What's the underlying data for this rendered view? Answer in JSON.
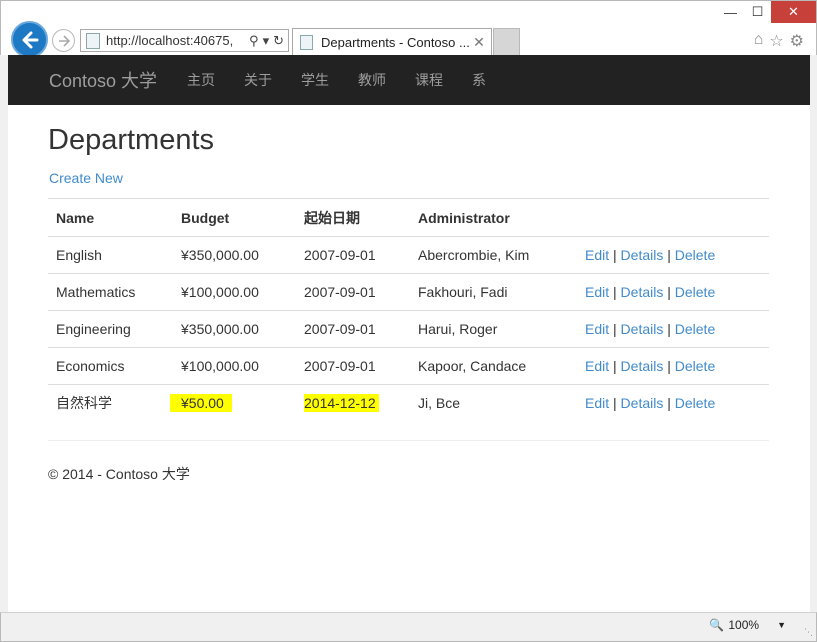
{
  "browser": {
    "url": "http://localhost:40675,",
    "tab_title": "Departments - Contoso ...",
    "zoom": "100%"
  },
  "navbar": {
    "brand": "Contoso 大学",
    "items": [
      "主页",
      "关于",
      "学生",
      "教师",
      "课程",
      "系"
    ]
  },
  "page": {
    "title": "Departments",
    "create_link": "Create New"
  },
  "table": {
    "headers": [
      "Name",
      "Budget",
      "起始日期",
      "Administrator"
    ],
    "rows": [
      {
        "name": "English",
        "budget": "¥350,000.00",
        "start": "2007-09-01",
        "admin": "Abercrombie, Kim"
      },
      {
        "name": "Mathematics",
        "budget": "¥100,000.00",
        "start": "2007-09-01",
        "admin": "Fakhouri, Fadi"
      },
      {
        "name": "Engineering",
        "budget": "¥350,000.00",
        "start": "2007-09-01",
        "admin": "Harui, Roger"
      },
      {
        "name": "Economics",
        "budget": "¥100,000.00",
        "start": "2007-09-01",
        "admin": "Kapoor, Candace"
      },
      {
        "name": "自然科学",
        "budget": "¥50.00",
        "start": "2014-12-12",
        "admin": "Ji, Bce"
      }
    ],
    "actions": {
      "edit": "Edit",
      "details": "Details",
      "delete": "Delete",
      "sep": "|"
    }
  },
  "footer": "© 2014 - Contoso 大学",
  "colors": {
    "highlight": "#ffff00",
    "link": "#428bca",
    "navbar": "#222222"
  }
}
